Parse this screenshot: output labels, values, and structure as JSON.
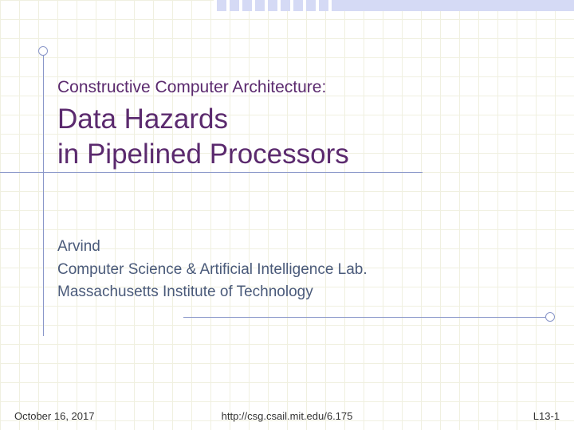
{
  "title": {
    "supertitle": "Constructive Computer Architecture:",
    "line1": "Data Hazards",
    "line2": "in Pipelined Processors"
  },
  "author": {
    "name": "Arvind",
    "affiliation1": "Computer Science & Artificial Intelligence Lab.",
    "affiliation2": "Massachusetts Institute of Technology"
  },
  "footer": {
    "date": "October 16, 2017",
    "url": "http://csg.csail.mit.edu/6.175",
    "slide": "L13-1"
  }
}
